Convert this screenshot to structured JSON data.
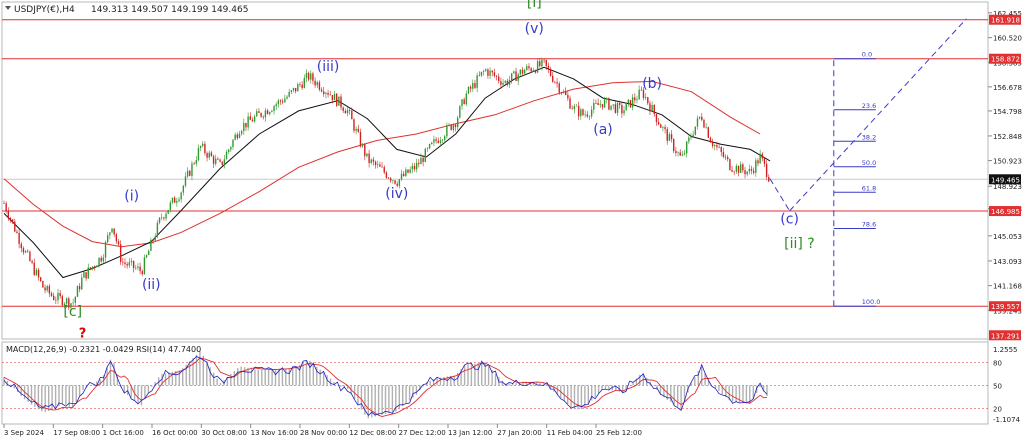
{
  "header": {
    "symbol_text": "USDJPY(€),H4",
    "ohlc_text": "149.313 149.507 149.199 149.465"
  },
  "price_axis": {
    "ticks": [
      "162.455",
      "160.520",
      "158.585",
      "156.678",
      "154.798",
      "152.848",
      "150.923",
      "148.923",
      "147.188",
      "145.053",
      "143.093",
      "141.168",
      "139.243"
    ],
    "tick_values": [
      162.455,
      160.52,
      158.585,
      156.678,
      154.798,
      152.848,
      150.923,
      148.923,
      147.188,
      145.053,
      143.093,
      141.168,
      139.243
    ],
    "current_label": "149.465",
    "current_value": 149.465
  },
  "level_labels": [
    {
      "text": "161.918",
      "value": 161.918
    },
    {
      "text": "158.872",
      "value": 158.872
    },
    {
      "text": "146.985",
      "value": 146.985
    },
    {
      "text": "139.557",
      "value": 139.557
    },
    {
      "text": "137.291",
      "value": 137.291
    }
  ],
  "time_axis": {
    "labels": [
      "3 Sep 2024",
      "17 Sep 08:00",
      "1 Oct 16:00",
      "16 Oct 00:00",
      "30 Oct 08:00",
      "13 Nov 16:00",
      "28 Nov 00:00",
      "12 Dec 08:00",
      "27 Dec 12:00",
      "13 Jan 12:00",
      "27 Jan 20:00",
      "11 Feb 04:00",
      "25 Feb 12:00"
    ]
  },
  "wave_labels": [
    {
      "text": "[i]",
      "color": "#2e8b22",
      "x": 54,
      "y": 162.9
    },
    {
      "text": "(v)",
      "color": "#3a3ac8",
      "x": 54,
      "y": 160.9
    },
    {
      "text": "(iii)",
      "color": "#3a3ac8",
      "x": 33,
      "y": 157.9
    },
    {
      "text": "(iv)",
      "color": "#3a3ac8",
      "x": 40,
      "y": 148.0
    },
    {
      "text": "(i)",
      "color": "#3a3ac8",
      "x": 13,
      "y": 147.8
    },
    {
      "text": "(ii)",
      "color": "#3a3ac8",
      "x": 15,
      "y": 140.9
    },
    {
      "text": "[c]",
      "color": "#2e8b22",
      "x": 7,
      "y": 138.8
    },
    {
      "text": "?",
      "color": "#e00000",
      "x": 8,
      "y": 137.1
    },
    {
      "text": "(a)",
      "color": "#3a3ac8",
      "x": 61,
      "y": 153.0
    },
    {
      "text": "(b)",
      "color": "#3a3ac8",
      "x": 66,
      "y": 156.6
    },
    {
      "text": "(c)",
      "color": "#3a3ac8",
      "x": 80,
      "y": 146.0
    },
    {
      "text": "[ii] ?",
      "color": "#2e8b22",
      "x": 81,
      "y": 144.1
    }
  ],
  "fib_labels": [
    {
      "text": "0.0",
      "value": 158.872
    },
    {
      "text": "23.6",
      "value": 154.89
    },
    {
      "text": "38.2",
      "value": 152.43
    },
    {
      "text": "50.0",
      "value": 150.44
    },
    {
      "text": "61.8",
      "value": 148.45
    },
    {
      "text": "78.6",
      "value": 145.62
    },
    {
      "text": "100.0",
      "value": 139.557
    }
  ],
  "macd_panel": {
    "header_text": "MACD(12,26,9) -0.2321 -0.0429  RSI(14) 47.7400",
    "ticks": [
      "1.2555",
      "80",
      "50",
      "20",
      "-1.1074"
    ],
    "tick_values": [
      1.2555,
      0.7,
      0.0,
      -0.7,
      -1.1074
    ]
  },
  "chart_data": {
    "type": "candlestick",
    "symbol": "USDJPY",
    "timeframe": "H4",
    "x_range": [
      0,
      100
    ],
    "ylim": [
      137.0,
      163.3
    ],
    "price_path": [
      [
        0,
        147.6
      ],
      [
        2,
        144.0
      ],
      [
        4,
        141.0
      ],
      [
        5,
        140.3
      ],
      [
        7,
        139.8
      ],
      [
        8,
        141.8
      ],
      [
        10,
        143.5
      ],
      [
        11,
        146.0
      ],
      [
        12,
        143.0
      ],
      [
        14,
        142.3
      ],
      [
        16,
        146.5
      ],
      [
        18,
        148.5
      ],
      [
        20,
        152.0
      ],
      [
        22,
        150.5
      ],
      [
        24,
        153.5
      ],
      [
        27,
        155.0
      ],
      [
        29,
        156.0
      ],
      [
        31,
        157.5
      ],
      [
        33,
        156.3
      ],
      [
        35,
        154.8
      ],
      [
        37,
        151.0
      ],
      [
        40,
        149.3
      ],
      [
        42,
        150.5
      ],
      [
        44,
        152.5
      ],
      [
        46,
        154.0
      ],
      [
        47,
        156.0
      ],
      [
        49,
        158.0
      ],
      [
        51,
        157.0
      ],
      [
        53,
        158.0
      ],
      [
        55,
        158.4
      ],
      [
        56,
        157.3
      ],
      [
        58,
        155.0
      ],
      [
        59,
        154.5
      ],
      [
        61,
        155.5
      ],
      [
        63,
        154.8
      ],
      [
        64,
        155.6
      ],
      [
        65,
        156.3
      ],
      [
        67,
        153.5
      ],
      [
        69,
        151.0
      ],
      [
        70,
        153.0
      ],
      [
        71,
        154.5
      ],
      [
        72,
        152.5
      ],
      [
        74,
        150.5
      ],
      [
        76,
        150.0
      ],
      [
        77,
        151.2
      ],
      [
        78,
        149.5
      ]
    ],
    "ma_black": [
      [
        0,
        146.8
      ],
      [
        3,
        144.5
      ],
      [
        6,
        141.8
      ],
      [
        9,
        142.5
      ],
      [
        12,
        143.5
      ],
      [
        15,
        144.6
      ],
      [
        18,
        147.0
      ],
      [
        22,
        150.3
      ],
      [
        26,
        153.0
      ],
      [
        30,
        154.8
      ],
      [
        34,
        155.6
      ],
      [
        37,
        154.2
      ],
      [
        40,
        151.8
      ],
      [
        43,
        151.2
      ],
      [
        46,
        153.0
      ],
      [
        49,
        155.8
      ],
      [
        52,
        157.3
      ],
      [
        55,
        158.2
      ],
      [
        58,
        157.3
      ],
      [
        61,
        155.8
      ],
      [
        64,
        155.3
      ],
      [
        67,
        154.5
      ],
      [
        70,
        152.8
      ],
      [
        73,
        152.2
      ],
      [
        76,
        151.8
      ],
      [
        78,
        150.9
      ]
    ],
    "ma_red": [
      [
        0,
        149.5
      ],
      [
        3,
        147.5
      ],
      [
        6,
        145.8
      ],
      [
        9,
        144.6
      ],
      [
        12,
        144.2
      ],
      [
        15,
        144.5
      ],
      [
        18,
        145.3
      ],
      [
        22,
        146.8
      ],
      [
        26,
        148.5
      ],
      [
        30,
        150.4
      ],
      [
        34,
        151.6
      ],
      [
        38,
        152.5
      ],
      [
        42,
        153.0
      ],
      [
        46,
        153.8
      ],
      [
        50,
        154.5
      ],
      [
        54,
        155.6
      ],
      [
        58,
        156.5
      ],
      [
        62,
        157.0
      ],
      [
        66,
        157.1
      ],
      [
        70,
        156.3
      ],
      [
        74,
        154.3
      ],
      [
        77,
        153.0
      ]
    ],
    "horizontal_levels": [
      161.918,
      158.872,
      146.985,
      139.557
    ],
    "current_price_level": 149.465,
    "projection": {
      "wave_c_target": [
        [
          78,
          149.5
        ],
        [
          80,
          147.0
        ]
      ],
      "wave_iii_projection": [
        [
          80,
          147.0
        ],
        [
          98,
          162.0
        ]
      ],
      "fib_anchor_line": [
        [
          84.5,
          139.557
        ],
        [
          84.5,
          158.872
        ]
      ]
    }
  }
}
